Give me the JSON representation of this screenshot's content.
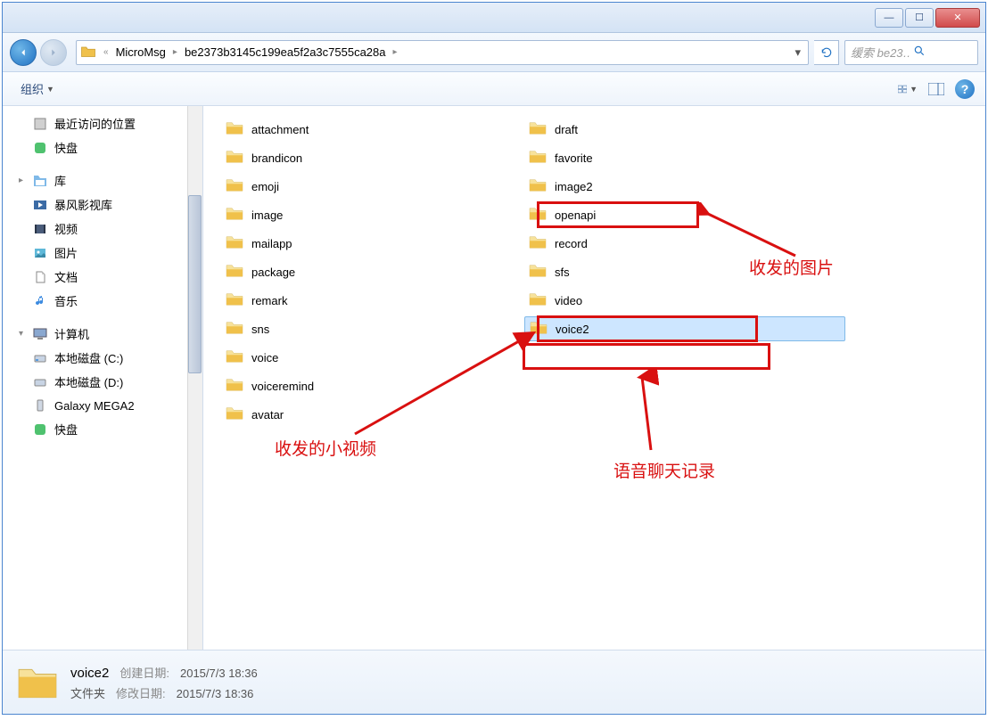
{
  "window_buttons": {
    "min": "—",
    "max": "☐",
    "close": "✕"
  },
  "breadcrumb": {
    "prefix": "«",
    "p1": "MicroMsg",
    "p2": "be2373b3145c199ea5f2a3c7555ca28a"
  },
  "search": {
    "placeholder": "缓索 be23…"
  },
  "toolbar": {
    "organize": "组织"
  },
  "sidebar": {
    "recent": "最近访问的位置",
    "kuaipan": "快盘",
    "libraries": "库",
    "lib_video": "暴风影视库",
    "lib_vid": "视频",
    "lib_pic": "图片",
    "lib_doc": "文档",
    "lib_music": "音乐",
    "computer": "计算机",
    "disk_c": "本地磁盘 (C:)",
    "disk_d": "本地磁盘 (D:)",
    "galaxy": "Galaxy MEGA2",
    "kuaipan2": "快盘"
  },
  "folders": {
    "col1": [
      {
        "n": "attachment"
      },
      {
        "n": "brandicon"
      },
      {
        "n": "emoji"
      },
      {
        "n": "image"
      },
      {
        "n": "mailapp"
      },
      {
        "n": "package"
      },
      {
        "n": "remark"
      },
      {
        "n": "sns"
      },
      {
        "n": "voice"
      },
      {
        "n": "voiceremind"
      }
    ],
    "col2": [
      {
        "n": "avatar"
      },
      {
        "n": "draft"
      },
      {
        "n": "favorite"
      },
      {
        "n": "image2"
      },
      {
        "n": "openapi"
      },
      {
        "n": "record"
      },
      {
        "n": "sfs"
      },
      {
        "n": "video"
      },
      {
        "n": "voice2",
        "sel": true
      }
    ]
  },
  "annotations": {
    "image2": "收发的图片",
    "video": "收发的小视频",
    "voice2": "语音聊天记录"
  },
  "details": {
    "name": "voice2",
    "type": "文件夹",
    "created_label": "创建日期:",
    "created": "2015/7/3 18:36",
    "modified_label": "修改日期:",
    "modified": "2015/7/3 18:36"
  }
}
